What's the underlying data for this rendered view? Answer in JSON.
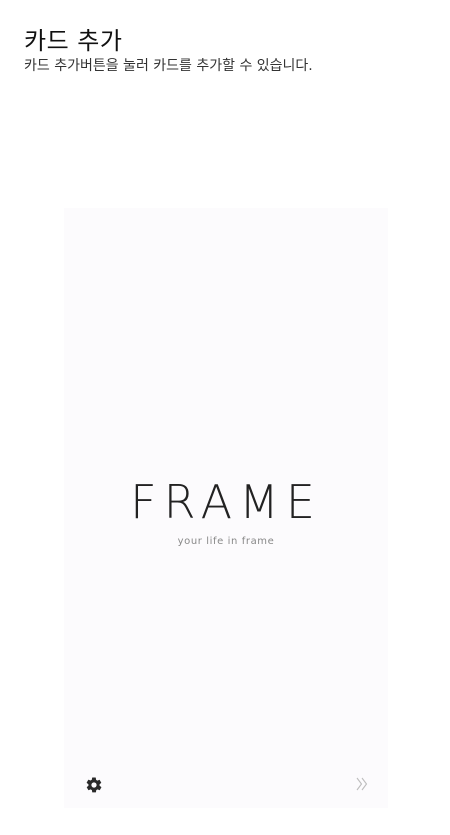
{
  "header": {
    "title": "카드 추가",
    "subtitle": "카드 추가버튼을 눌러 카드를 추가할 수 있습니다."
  },
  "card": {
    "brand_name": "FRAME",
    "tagline": "your life in frame",
    "settings_icon": "gear-icon",
    "next_icon": "double-chevron-right-icon"
  }
}
